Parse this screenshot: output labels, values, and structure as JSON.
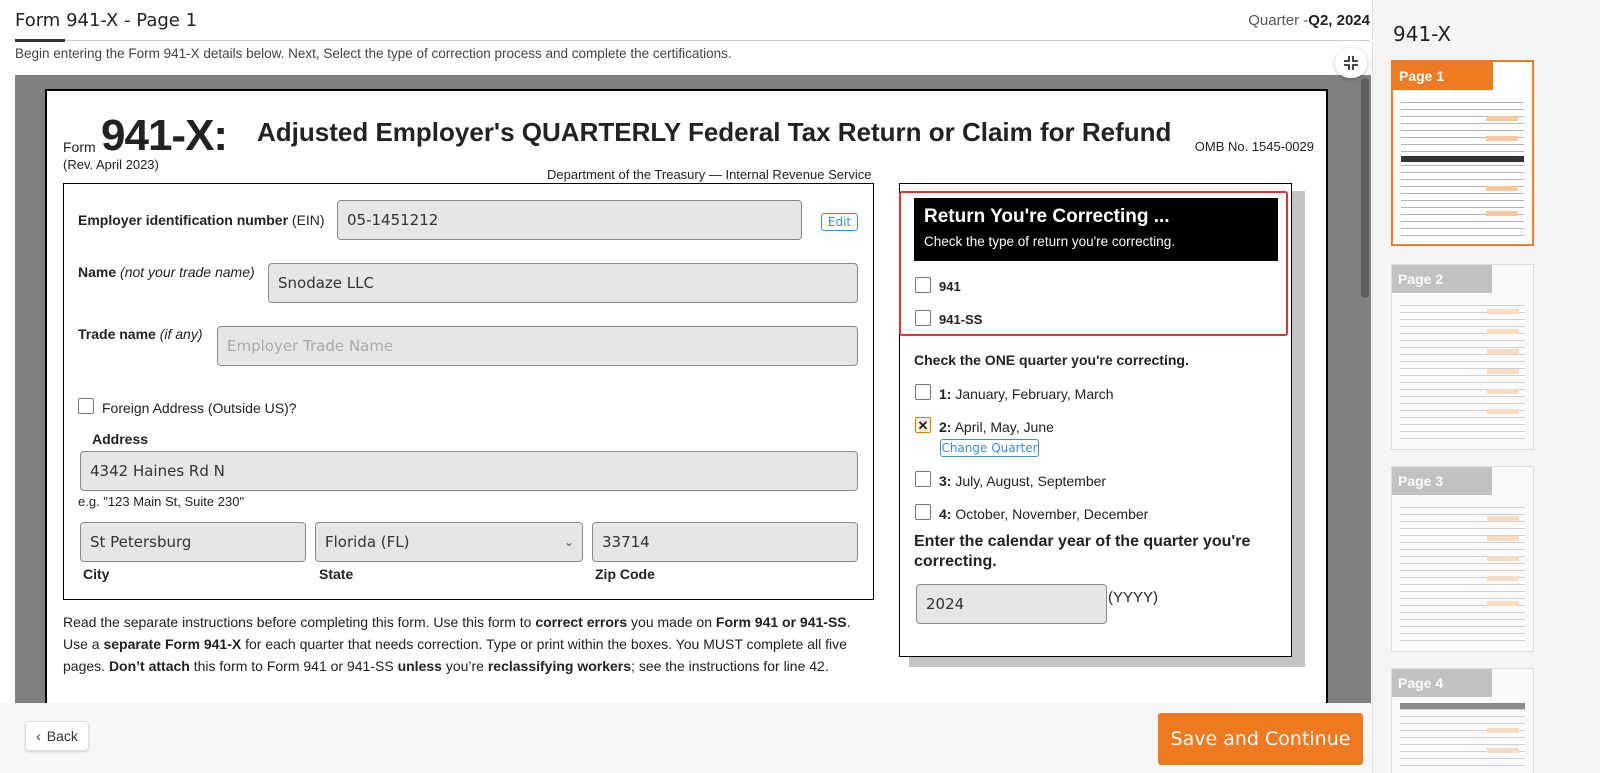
{
  "header": {
    "title": "Form 941-X - Page 1",
    "quarter_prefix": "Quarter -",
    "quarter_value": "Q2, 2024",
    "subtitle": "Begin entering the Form 941-X details below. Next, Select the type of correction process and complete the certifications."
  },
  "form": {
    "form_word": "Form",
    "form_number": "941-X:",
    "revision": "(Rev. April 2023)",
    "title": "Adjusted Employer's QUARTERLY Federal Tax Return or Claim for Refund",
    "omb": "OMB No. 1545-0029",
    "department": "Department of the Treasury — Internal Revenue Service",
    "ein_label": "Employer identification number",
    "ein_suffix": " (EIN)",
    "ein_value": "05-1451212",
    "edit_label": "Edit",
    "name_label": "Name",
    "name_hint": " (not your trade name)",
    "name_value": "Snodaze LLC",
    "trade_label": "Trade name",
    "trade_hint": " (if any)",
    "trade_placeholder": "Employer Trade Name",
    "foreign_label": "Foreign Address (Outside US)?",
    "address_label": "Address",
    "address_value": "4342 Haines Rd N",
    "address_example": "e.g. \"123 Main St, Suite 230\"",
    "city_value": "St Petersburg",
    "city_label": "City",
    "state_value": "Florida (FL)",
    "state_label": "State",
    "zip_value": "33714",
    "zip_label": "Zip Code"
  },
  "instructions": {
    "p1": "Read the separate instructions before completing this form. Use this form to ",
    "b1": "correct errors",
    "p2": " you made on ",
    "b2": "Form 941 or 941-SS",
    "p3": ". Use a ",
    "b3": "separate Form 941-X",
    "p4": " for each quarter that needs correction. Type or print within the boxes. You MUST complete all five pages. ",
    "b4": "Don’t attach",
    "p5": " this form to Form 941 or 941-SS ",
    "b5": "unless",
    "p6": " you’re ",
    "b6": "reclassifying workers",
    "p7": "; see the instructions for line 42."
  },
  "correction_panel": {
    "header_title": "Return You're Correcting ...",
    "header_sub": "Check the type of return you're correcting.",
    "opt_941": "941",
    "opt_941ss": "941-SS",
    "quarter_heading": "Check the ONE quarter you're correcting.",
    "q1_num": "1:",
    "q1_text": " January, February, March",
    "q2_num": "2:",
    "q2_text": " April, May, June",
    "q2_mark": "✕",
    "change_quarter": "Change Quarter",
    "q3_num": "3:",
    "q3_text": " July, August, September",
    "q4_num": "4:",
    "q4_text": " October, November, December",
    "year_label": "Enter the calendar year of the quarter you're correcting.",
    "year_value": "2024",
    "year_format": "(YYYY)"
  },
  "footer": {
    "back_label": "Back",
    "back_icon": "‹",
    "save_label": "Save and Continue"
  },
  "sidebar": {
    "title": "941-X",
    "pages": [
      "Page 1",
      "Page 2",
      "Page 3",
      "Page 4"
    ]
  },
  "colors": {
    "accent": "#f07a22",
    "highlight": "#dd3333",
    "link": "#3a8fd0"
  }
}
